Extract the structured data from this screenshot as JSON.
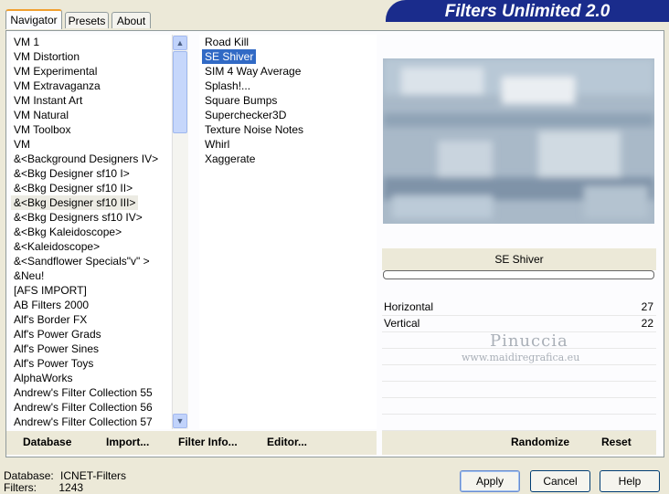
{
  "tabs": [
    "Navigator",
    "Presets",
    "About"
  ],
  "banner": "Filters Unlimited 2.0",
  "categories": [
    "VM 1",
    "VM Distortion",
    "VM Experimental",
    "VM Extravaganza",
    "VM Instant Art",
    "VM Natural",
    "VM Toolbox",
    "VM",
    "&<Background Designers IV>",
    "&<Bkg Designer sf10 I>",
    "&<Bkg Designer sf10 II>",
    "&<Bkg Designer sf10 III>",
    "&<Bkg Designers sf10 IV>",
    "&<Bkg Kaleidoscope>",
    "&<Kaleidoscope>",
    "&<Sandflower Specials\"v\" >",
    "&Neu!",
    "[AFS IMPORT]",
    "AB Filters 2000",
    "Alf's Border FX",
    "Alf's Power Grads",
    "Alf's Power Sines",
    "Alf's Power Toys",
    "AlphaWorks",
    "Andrew's Filter Collection 55",
    "Andrew's Filter Collection 56",
    "Andrew's Filter Collection 57"
  ],
  "selected_category": "&<Bkg Designer sf10 III>",
  "filters": [
    "Road Kill",
    "SE Shiver",
    "SIM 4 Way Average",
    "Splash!...",
    "Square Bumps",
    "Superchecker3D",
    "Texture Noise Notes",
    "Whirl",
    "Xaggerate"
  ],
  "selected_filter": "SE Shiver",
  "bottom_buttons": {
    "database": "Database",
    "import": "Import...",
    "filter_info": "Filter Info...",
    "editor": "Editor...",
    "randomize": "Randomize",
    "reset": "Reset"
  },
  "filter_name": "SE Shiver",
  "params": [
    {
      "name": "Horizontal",
      "value": "27"
    },
    {
      "name": "Vertical",
      "value": "22"
    }
  ],
  "watermark": {
    "line1": "Pinuccia",
    "line2": "www.maidiregrafica.eu"
  },
  "status": {
    "database_label": "Database:",
    "database_value": "ICNET-Filters",
    "filters_label": "Filters:",
    "filters_value": "1243"
  },
  "dialog_buttons": {
    "apply": "Apply",
    "cancel": "Cancel",
    "help": "Help"
  },
  "icons": {
    "scroll_up": "chevron-up-icon",
    "scroll_down": "chevron-down-icon"
  }
}
